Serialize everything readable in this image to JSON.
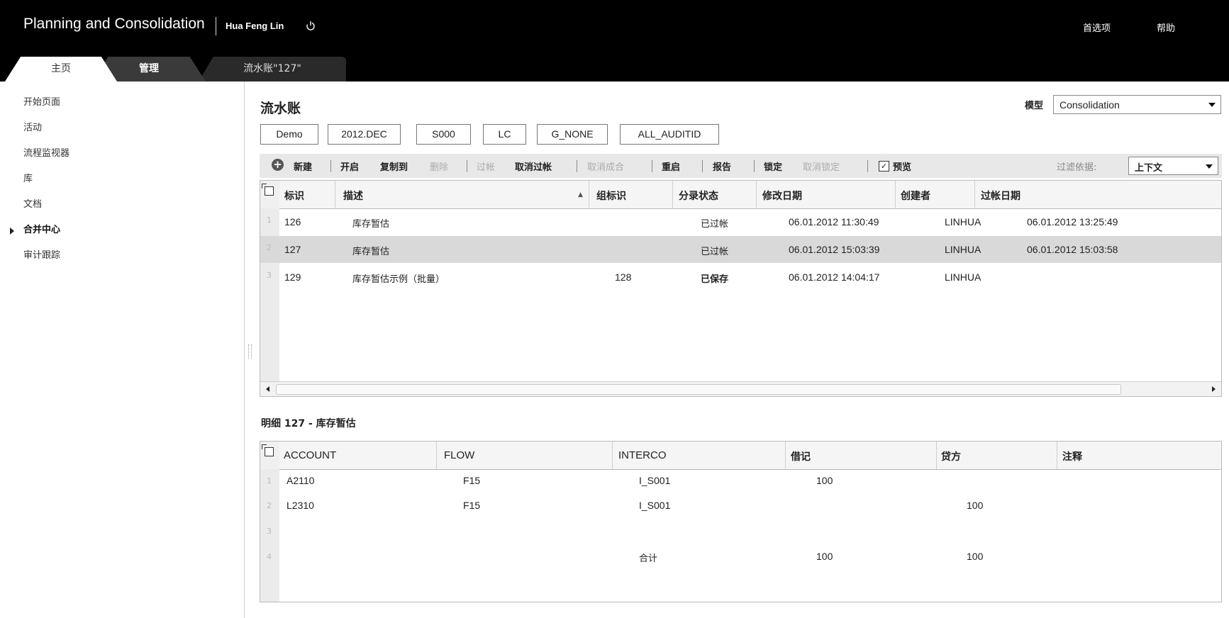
{
  "header": {
    "app_title": "Planning and Consolidation",
    "user_name": "Hua Feng Lin",
    "preferences": "首选项",
    "help": "帮助",
    "tabs": [
      {
        "label": "主页"
      },
      {
        "label": "管理"
      },
      {
        "label": "流水账\"127\""
      }
    ]
  },
  "sidebar": {
    "items": [
      {
        "label": "开始页面"
      },
      {
        "label": "活动"
      },
      {
        "label": "流程监视器"
      },
      {
        "label": "库"
      },
      {
        "label": "文档"
      },
      {
        "label": "合并中心"
      },
      {
        "label": "审计跟踪"
      }
    ]
  },
  "main": {
    "title": "流水账",
    "model_label": "模型",
    "model_value": "Consolidation",
    "context": [
      "Demo",
      "2012.DEC",
      "S000",
      "LC",
      "G_NONE",
      "ALL_AUDITID"
    ],
    "toolbar": {
      "new": "新建",
      "open": "开启",
      "copy_to": "复制到",
      "delete": "删除",
      "post": "过帐",
      "cancel_post": "取消过帐",
      "cancel_group": "取消成合",
      "reopen": "重启",
      "report": "报告",
      "lock": "锁定",
      "unlock": "取消锁定",
      "preview": "预览",
      "filter_label": "过滤依据:",
      "filter_value": "上下文"
    },
    "journal_grid": {
      "columns": [
        "标识",
        "描述",
        "组标识",
        "分录状态",
        "修改日期",
        "创建者",
        "过帐日期"
      ],
      "rows": [
        {
          "num": "1",
          "id": "126",
          "desc": "库存暂估",
          "group": "",
          "status": "已过帐",
          "modified": "06.01.2012 11:30:49",
          "creator": "LINHUA",
          "posted": "06.01.2012 13:25:49"
        },
        {
          "num": "2",
          "id": "127",
          "desc": "库存暂估",
          "group": "",
          "status": "已过帐",
          "modified": "06.01.2012 15:03:39",
          "creator": "LINHUA",
          "posted": "06.01.2012 15:03:58"
        },
        {
          "num": "3",
          "id": "129",
          "desc": "库存暂估示例（批量）",
          "group": "128",
          "status": "已保存",
          "modified": "06.01.2012 14:04:17",
          "creator": "LINHUA",
          "posted": ""
        }
      ]
    },
    "detail_title": "明细 127 - 库存暂估",
    "detail_grid": {
      "columns": [
        "ACCOUNT",
        "FLOW",
        "INTERCO",
        "借记",
        "贷方",
        "注释"
      ],
      "rows": [
        {
          "num": "1",
          "account": "A2110",
          "flow": "F15",
          "interco": "I_S001",
          "debit": "100",
          "credit": "",
          "note": ""
        },
        {
          "num": "2",
          "account": "L2310",
          "flow": "F15",
          "interco": "I_S001",
          "debit": "",
          "credit": "100",
          "note": ""
        },
        {
          "num": "3",
          "account": "",
          "flow": "",
          "interco": "",
          "debit": "",
          "credit": "",
          "note": ""
        },
        {
          "num": "4",
          "account": "",
          "flow": "",
          "interco": "合计",
          "debit": "100",
          "credit": "100",
          "note": ""
        }
      ]
    }
  }
}
